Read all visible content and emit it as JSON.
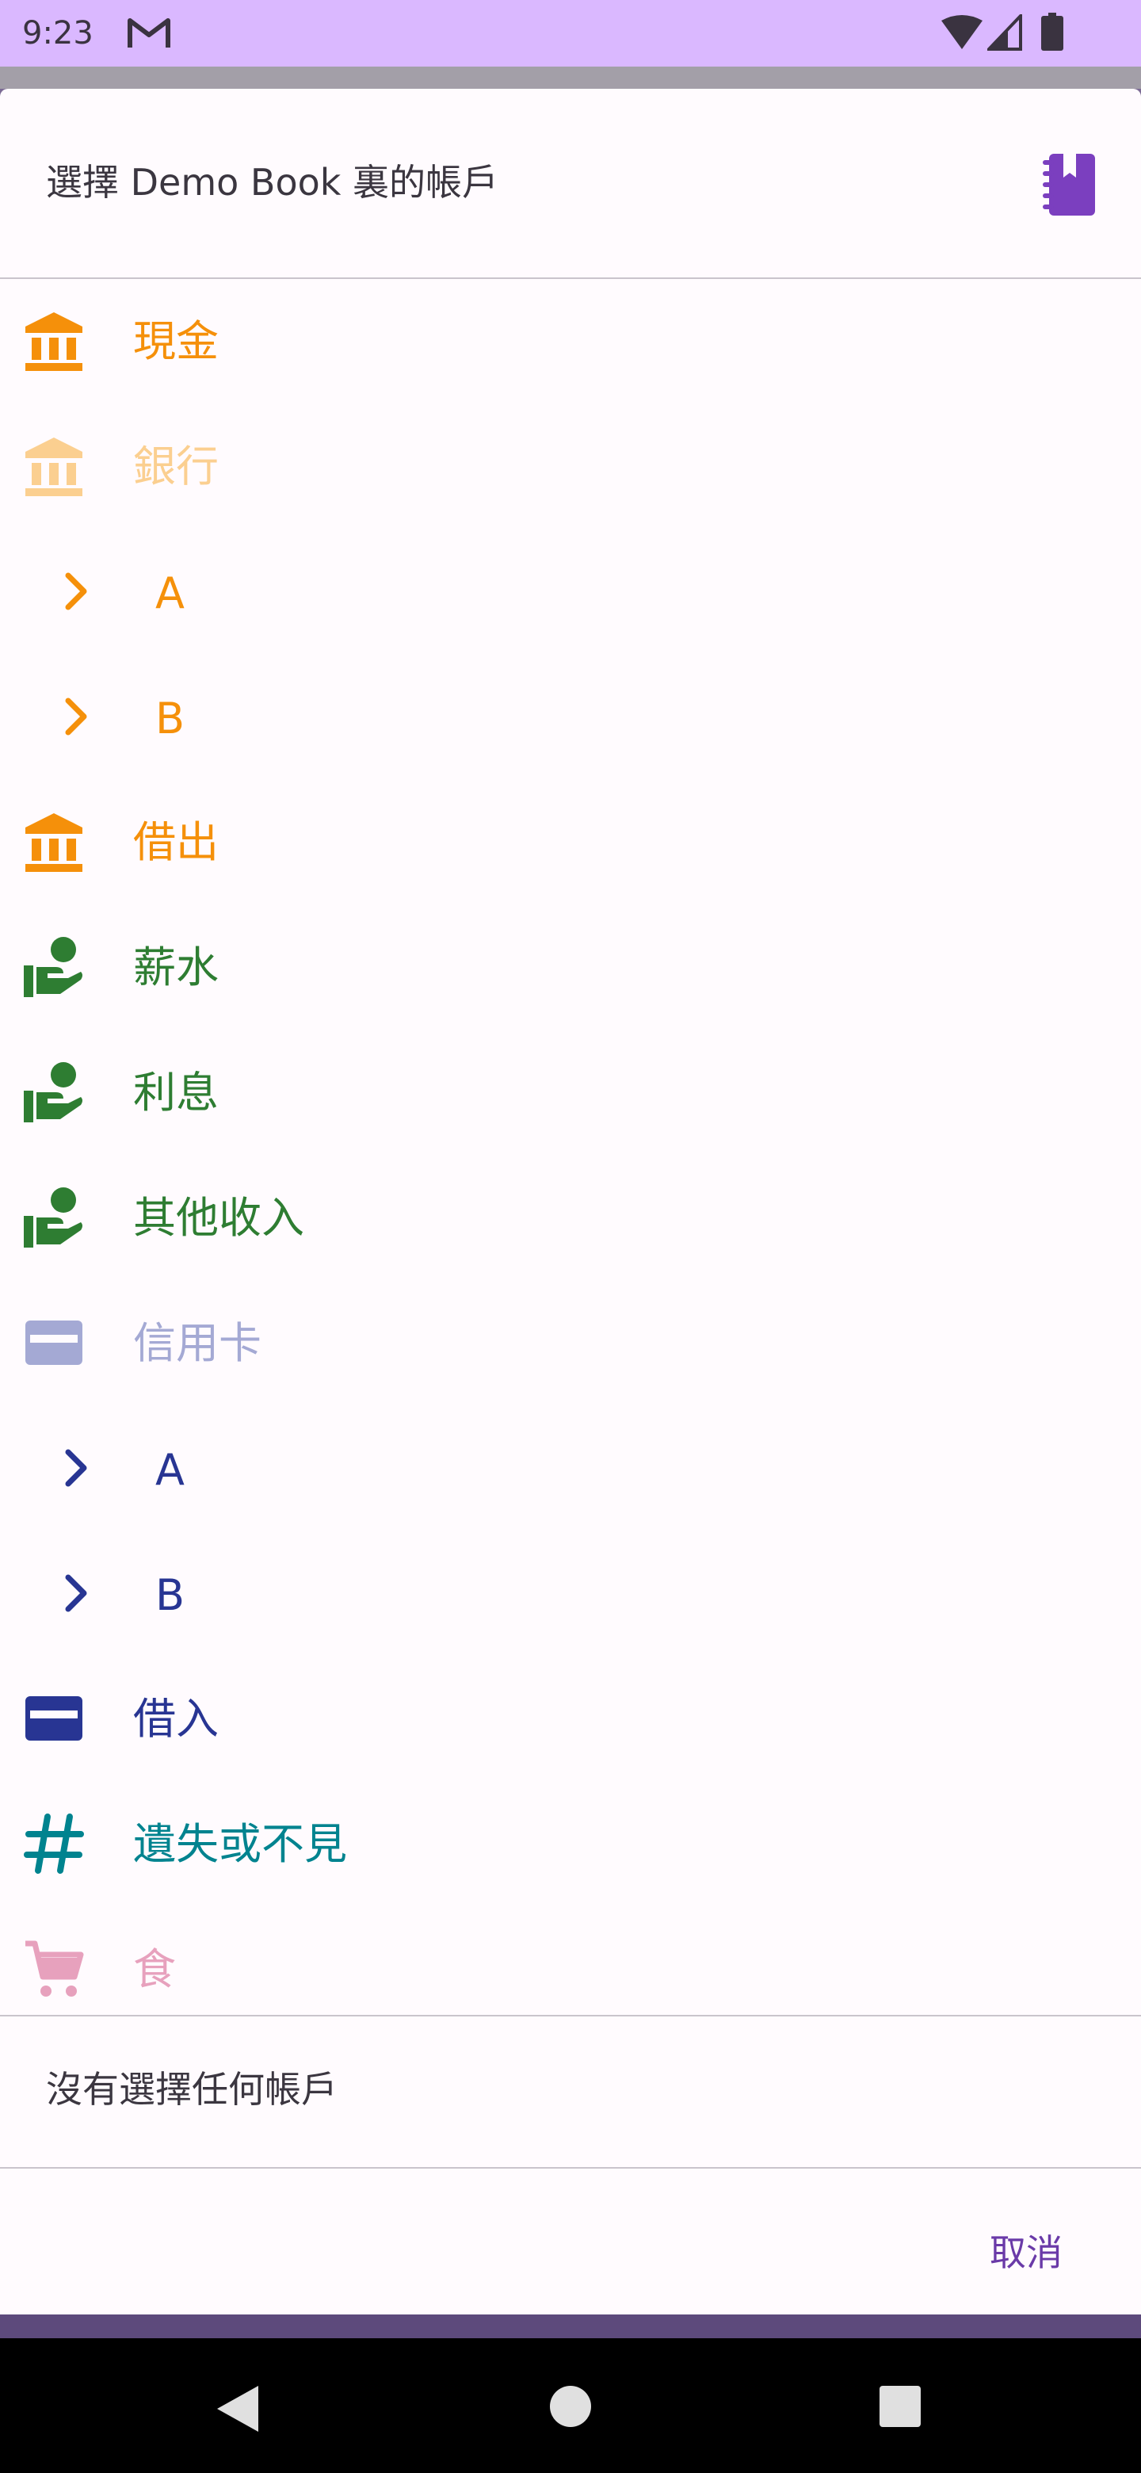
{
  "status_bar": {
    "time": "9:23",
    "icons": [
      "gmail-icon",
      "wifi-icon",
      "signal-icon",
      "battery-icon"
    ]
  },
  "dialog": {
    "title": "選擇 Demo Book 裏的帳戶",
    "title_icon": "book-icon",
    "accounts": [
      {
        "label": "現金",
        "icon": "bank-icon",
        "color": "#f5900a"
      },
      {
        "label": "銀行",
        "icon": "bank-icon",
        "color": "#fbcf90",
        "faded": true
      },
      {
        "label": "A",
        "icon": "chevron-right-icon",
        "color": "#f5900a"
      },
      {
        "label": "B",
        "icon": "chevron-right-icon",
        "color": "#f5900a"
      },
      {
        "label": "借出",
        "icon": "bank-icon",
        "color": "#f5900a"
      },
      {
        "label": "薪水",
        "icon": "hand-coin-icon",
        "color": "#2e7d32"
      },
      {
        "label": "利息",
        "icon": "hand-coin-icon",
        "color": "#2e7d32"
      },
      {
        "label": "其他收入",
        "icon": "hand-coin-icon",
        "color": "#2e7d32"
      },
      {
        "label": "信用卡",
        "icon": "credit-card-icon",
        "color": "#a4a9d4",
        "faded": true
      },
      {
        "label": "A",
        "icon": "chevron-right-icon",
        "color": "#283593"
      },
      {
        "label": "B",
        "icon": "chevron-right-icon",
        "color": "#283593"
      },
      {
        "label": "借入",
        "icon": "credit-card-icon",
        "color": "#283593"
      },
      {
        "label": "遺失或不見",
        "icon": "hash-icon",
        "color": "#00838f"
      },
      {
        "label": "食",
        "icon": "shopping-cart-icon",
        "color": "#e7a1bd",
        "faded": true
      }
    ],
    "no_selection_label": "沒有選擇任何帳戶",
    "cancel_label": "取消"
  },
  "nav_bar": {
    "icons": [
      "back-icon",
      "home-icon",
      "recents-icon"
    ]
  },
  "colors": {
    "status_bar": "#dab8ff",
    "accent": "#6a3aa8",
    "orange": "#f5900a",
    "green": "#2e7d32",
    "indigo": "#283593",
    "teal": "#00838f",
    "pink": "#e7a1bd"
  }
}
